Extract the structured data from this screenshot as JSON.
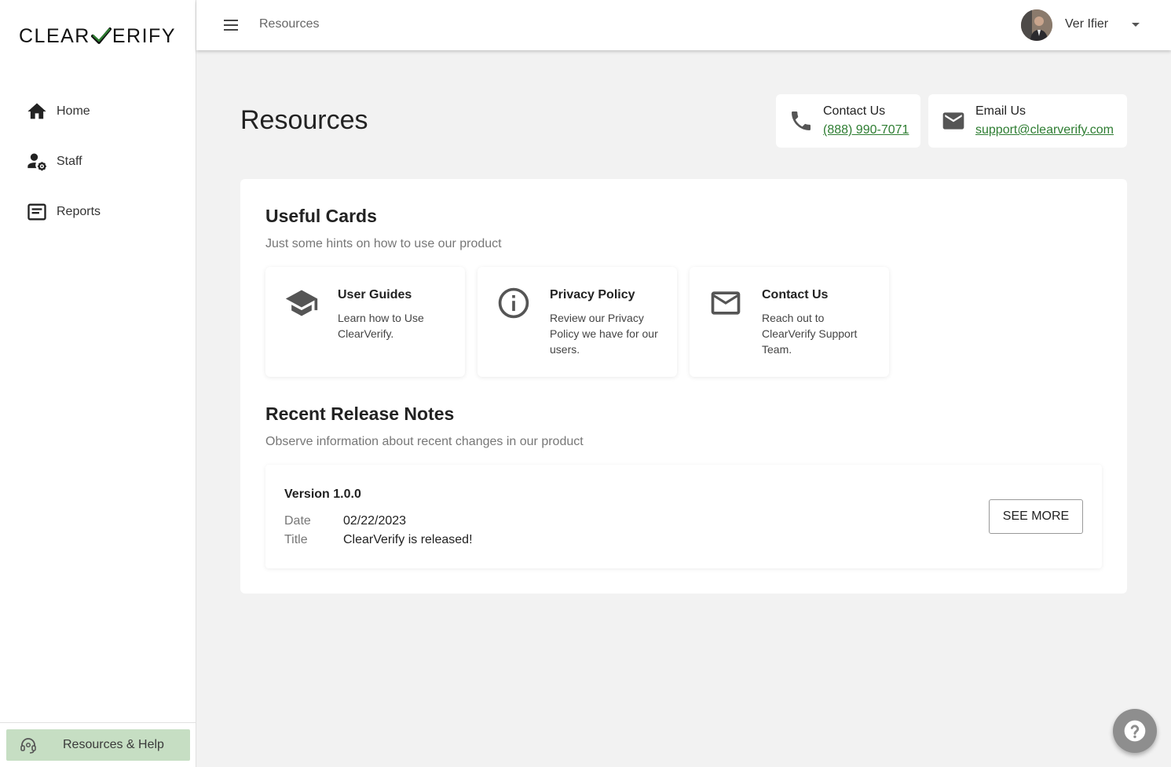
{
  "brand": {
    "logo_left": "CLEAR",
    "logo_right": "ERIFY",
    "check_color": "#2e7d32"
  },
  "sidebar": {
    "items": [
      {
        "label": "Home",
        "icon": "home-icon"
      },
      {
        "label": "Staff",
        "icon": "staff-icon"
      },
      {
        "label": "Reports",
        "icon": "reports-icon"
      }
    ],
    "help_label": "Resources & Help",
    "help_icon": "headset-icon"
  },
  "topbar": {
    "breadcrumb": "Resources",
    "user_name": "Ver Ifier",
    "menu_icon": "hamburger-menu-icon",
    "caret_icon": "chevron-down-icon"
  },
  "page": {
    "title": "Resources",
    "contact_phone": {
      "title": "Contact Us",
      "value": "(888) 990-7071",
      "icon": "phone-icon"
    },
    "contact_email": {
      "title": "Email Us",
      "value": "support@clearverify.com",
      "icon": "mail-icon"
    }
  },
  "useful_cards": {
    "title": "Useful Cards",
    "subtitle": "Just some hints on how to use our product",
    "cards": [
      {
        "title": "User Guides",
        "description": "Learn how to Use ClearVerify.",
        "icon": "graduation-cap-icon"
      },
      {
        "title": "Privacy Policy",
        "description": "Review our Privacy Policy we have for our users.",
        "icon": "info-icon"
      },
      {
        "title": "Contact Us",
        "description": "Reach out to ClearVerify Support Team.",
        "icon": "mail-icon"
      }
    ]
  },
  "release_notes": {
    "title": "Recent Release Notes",
    "subtitle": "Observe information about recent changes in our product",
    "entries": [
      {
        "version": "Version 1.0.0",
        "date_label": "Date",
        "date": "02/22/2023",
        "title_label": "Title",
        "title": "ClearVerify is released!",
        "button": "SEE MORE"
      }
    ]
  },
  "fab_icon": "help-question-icon",
  "colors": {
    "accent_green": "#2e7d32",
    "help_button_bg": "#c6dec3",
    "fab_bg": "#8e8e8e"
  }
}
